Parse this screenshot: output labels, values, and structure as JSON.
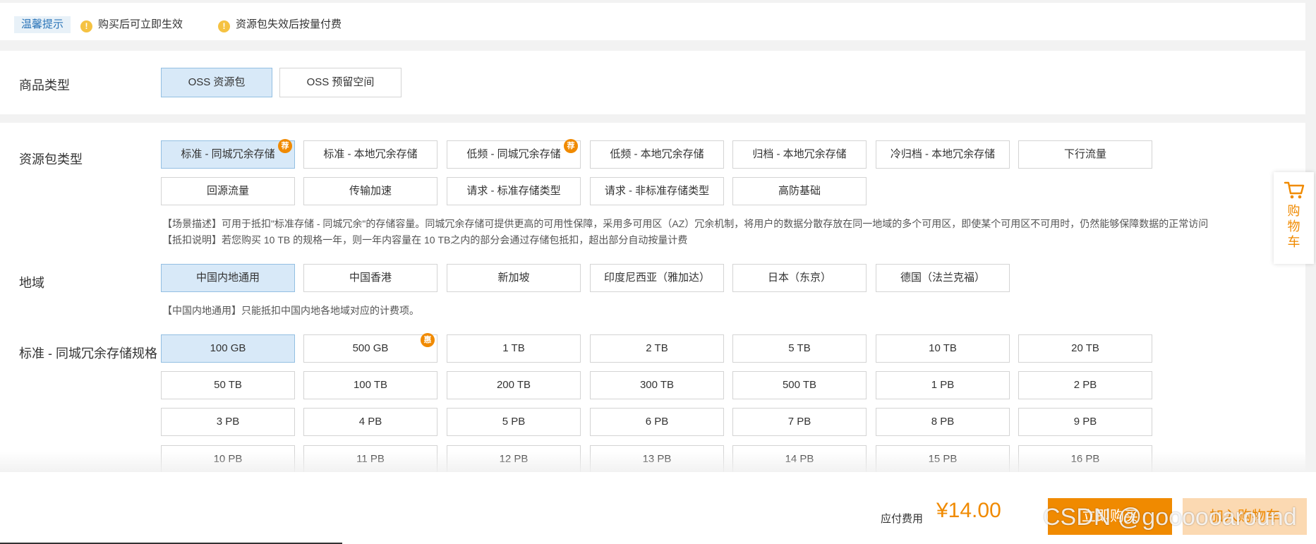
{
  "notice": {
    "tag": "温馨提示",
    "items": [
      "购买后可立即生效",
      "资源包失效后按量付费"
    ],
    "icon": "warning-icon"
  },
  "product_type": {
    "label": "商品类型",
    "options": [
      "OSS 资源包",
      "OSS 预留空间"
    ],
    "selected": "OSS 资源包"
  },
  "package_type": {
    "label": "资源包类型",
    "options": [
      {
        "label": "标准 - 同城冗余存储",
        "badge": "荐",
        "selected": true
      },
      {
        "label": "标准 - 本地冗余存储"
      },
      {
        "label": "低频 - 同城冗余存储",
        "badge": "荐"
      },
      {
        "label": "低频 - 本地冗余存储"
      },
      {
        "label": "归档 - 本地冗余存储"
      },
      {
        "label": "冷归档 - 本地冗余存储"
      },
      {
        "label": "下行流量"
      },
      {
        "label": "回源流量"
      },
      {
        "label": "传输加速"
      },
      {
        "label": "请求 - 标准存储类型"
      },
      {
        "label": "请求 - 非标准存储类型"
      },
      {
        "label": "高防基础"
      }
    ],
    "scenario": "【场景描述】可用于抵扣\"标准存储 - 同城冗余\"的存储容量。同城冗余存储可提供更高的可用性保障，采用多可用区（AZ）冗余机制，将用户的数据分散存放在同一地域的多个可用区，即使某个可用区不可用时，仍然能够保障数据的正常访问",
    "deduction": "【抵扣说明】若您购买 10 TB 的规格一年，则一年内容量在 10 TB之内的部分会通过存储包抵扣，超出部分自动按量计费"
  },
  "region": {
    "label": "地域",
    "options": [
      "中国内地通用",
      "中国香港",
      "新加坡",
      "印度尼西亚（雅加达）",
      "日本（东京）",
      "德国（法兰克福）"
    ],
    "selected": "中国内地通用",
    "note": "【中国内地通用】只能抵扣中国内地各地域对应的计费项。"
  },
  "spec": {
    "label": "标准 - 同城冗余存储规格",
    "options": [
      {
        "label": "100 GB",
        "selected": true
      },
      {
        "label": "500 GB",
        "badge": "惠"
      },
      {
        "label": "1 TB"
      },
      {
        "label": "2 TB"
      },
      {
        "label": "5 TB"
      },
      {
        "label": "10 TB"
      },
      {
        "label": "20 TB"
      },
      {
        "label": "50 TB"
      },
      {
        "label": "100 TB"
      },
      {
        "label": "200 TB"
      },
      {
        "label": "300 TB"
      },
      {
        "label": "500 TB"
      },
      {
        "label": "1 PB"
      },
      {
        "label": "2 PB"
      },
      {
        "label": "3 PB"
      },
      {
        "label": "4 PB"
      },
      {
        "label": "5 PB"
      },
      {
        "label": "6 PB"
      },
      {
        "label": "7 PB"
      },
      {
        "label": "8 PB"
      },
      {
        "label": "9 PB"
      },
      {
        "label": "10 PB"
      },
      {
        "label": "11 PB"
      },
      {
        "label": "12 PB"
      },
      {
        "label": "13 PB"
      },
      {
        "label": "14 PB"
      },
      {
        "label": "15 PB"
      },
      {
        "label": "16 PB"
      }
    ]
  },
  "cart_tab": {
    "label": "购物车",
    "icon": "cart-icon"
  },
  "footer": {
    "fee_label": "应付费用",
    "fee_value": "¥14.00",
    "buy_label": "立即购买",
    "add_cart_label": "加入购物车",
    "watermark": "CSDN @goooooaround"
  },
  "colors": {
    "accent": "#f08a00",
    "selected_bg": "#d8e9f8",
    "selected_border": "#93bfe2",
    "notice_tag": "#2a74b8"
  }
}
